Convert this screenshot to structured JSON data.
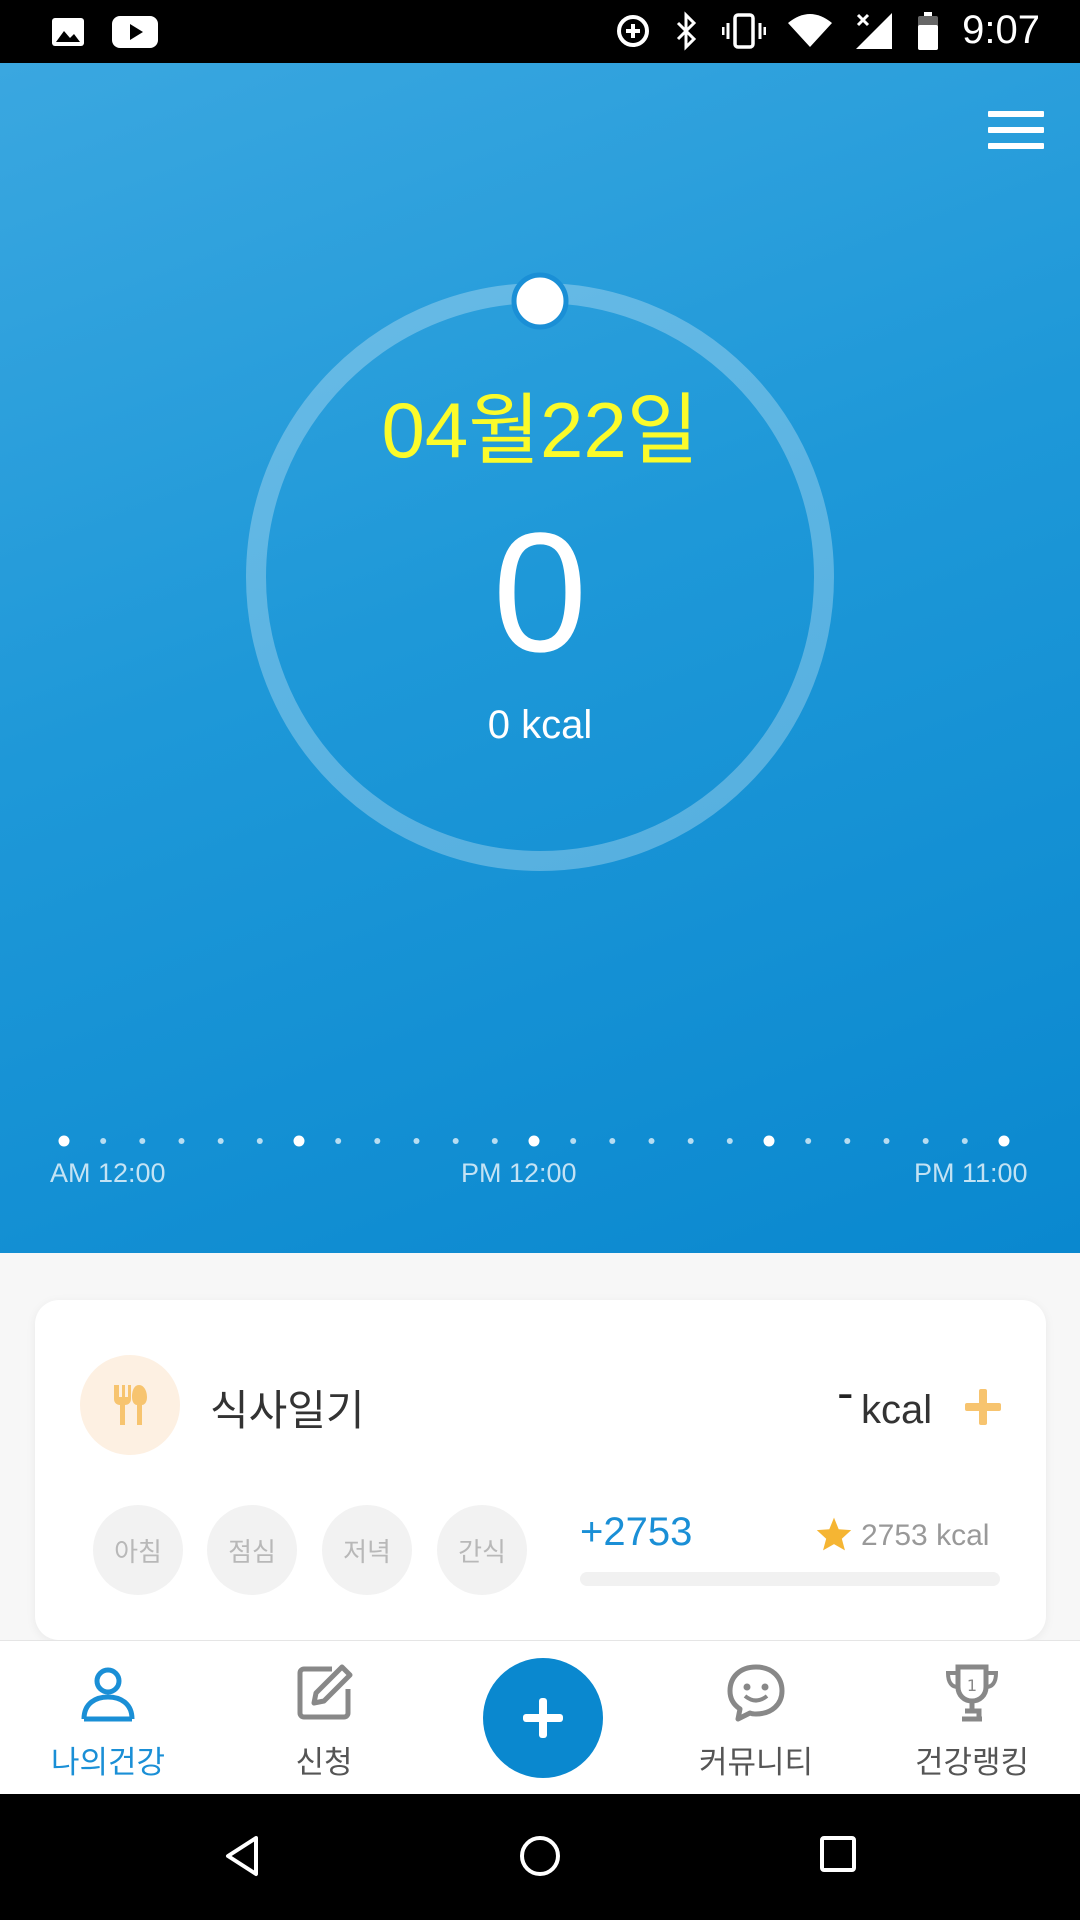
{
  "status_bar": {
    "time": "9:07",
    "left_icons": [
      "image-icon",
      "youtube-icon"
    ],
    "right_icons": [
      "data-saver-icon",
      "bluetooth-icon",
      "vibrate-icon",
      "wifi-icon",
      "signal-icon",
      "battery-icon"
    ]
  },
  "header": {
    "menu_icon": "hamburger-menu-icon"
  },
  "summary": {
    "date": "04월22일",
    "count": "0",
    "kcal": "0 kcal"
  },
  "timeline": {
    "labels": [
      "AM 12:00",
      "PM 12:00",
      "PM 11:00"
    ]
  },
  "meal_card": {
    "title": "식사일기",
    "dash": "-",
    "kcal_unit": "kcal",
    "meals": [
      "아침",
      "점심",
      "저녁",
      "간식"
    ],
    "plus_value": "+2753",
    "goal": "2753 kcal",
    "progress": 0
  },
  "bottom_nav": {
    "items": [
      {
        "label": "나의건강",
        "icon": "person-icon",
        "active": true
      },
      {
        "label": "신청",
        "icon": "edit-icon",
        "active": false
      },
      {
        "label": "커뮤니티",
        "icon": "chat-smile-icon",
        "active": false
      },
      {
        "label": "건강랭킹",
        "icon": "trophy-icon",
        "active": false
      }
    ],
    "fab_icon": "plus-icon"
  },
  "colors": {
    "accent": "#1a8fd6",
    "date_yellow": "#fbfb2a",
    "meal_orange": "#f7c46f"
  }
}
